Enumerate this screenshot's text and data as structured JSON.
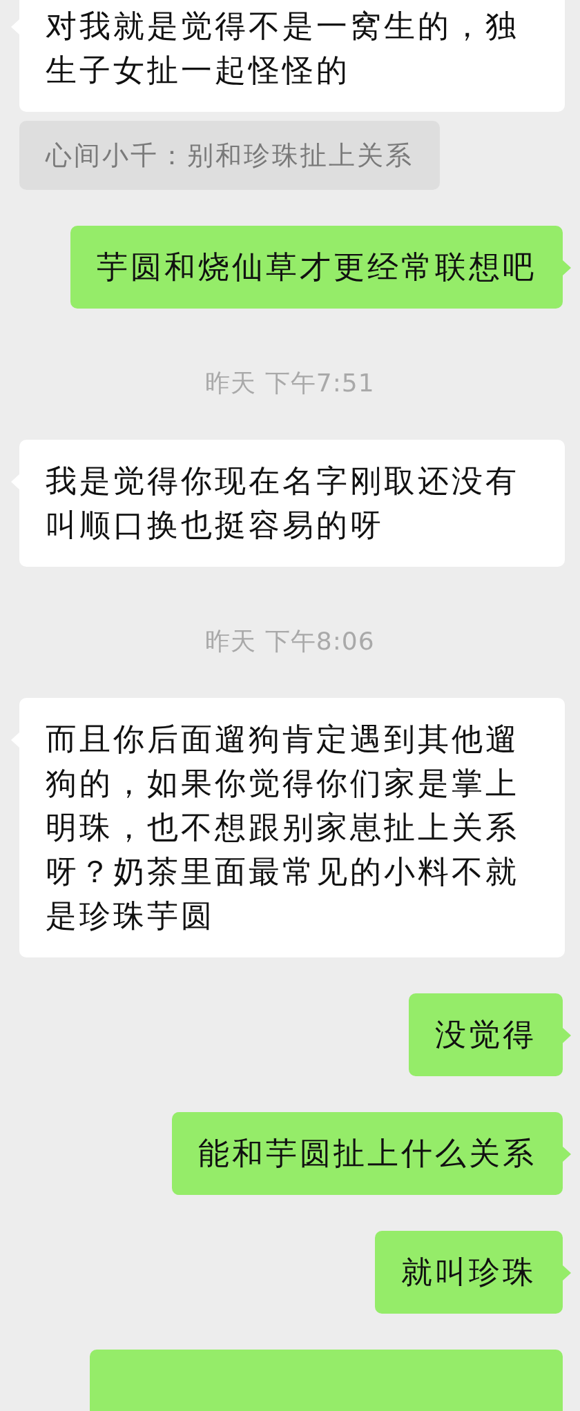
{
  "messages": [
    {
      "kind": "received",
      "text": "对我就是觉得不是一窝生的，独生子女扯一起怪怪的"
    },
    {
      "kind": "system",
      "text": "心间小千：别和珍珠扯上关系"
    },
    {
      "kind": "sent",
      "text": "芋圆和烧仙草才更经常联想吧"
    },
    {
      "kind": "time",
      "text": "昨天 下午7:51"
    },
    {
      "kind": "received",
      "text": "我是觉得你现在名字刚取还没有叫顺口换也挺容易的呀"
    },
    {
      "kind": "time",
      "text": "昨天 下午8:06"
    },
    {
      "kind": "received",
      "text": "而且你后面遛狗肯定遇到其他遛狗的，如果你觉得你们家是掌上明珠，也不想跟别家崽扯上关系呀？奶茶里面最常见的小料不就是珍珠芋圆"
    },
    {
      "kind": "sent",
      "text": "没觉得"
    },
    {
      "kind": "sent",
      "text": "能和芋圆扯上什么关系"
    },
    {
      "kind": "sent",
      "text": "就叫珍珠"
    },
    {
      "kind": "cut"
    }
  ]
}
